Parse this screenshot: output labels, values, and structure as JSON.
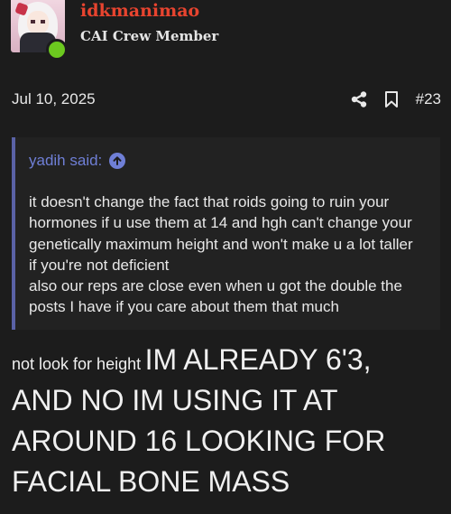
{
  "user": {
    "name": "idkmanimao",
    "title": "CAI Crew Member",
    "online": true,
    "name_color": "#e8442f",
    "online_color": "#6cc91f"
  },
  "post": {
    "date": "Jul 10, 2025",
    "number": "#23",
    "actions": [
      "share-icon",
      "bookmark-icon"
    ]
  },
  "quote": {
    "author_said": "yadih said:",
    "accent_color": "#6f7fd6",
    "lines": [
      "it doesn't change the fact that roids going to ruin your",
      "hormones if u use them at 14 and hgh can't change your",
      "genetically maximum height and won't make u a lot taller",
      "if you're not deficient",
      "also our reps are close even when u got the double the",
      "posts I have if you care about them that much"
    ]
  },
  "reply": {
    "small_text": "not look for height",
    "big_lines": [
      "IM ALREADY 6'3,",
      "AND NO IM USING IT AT",
      "AROUND 16 LOOKING FOR",
      "FACIAL BONE MASS"
    ]
  }
}
